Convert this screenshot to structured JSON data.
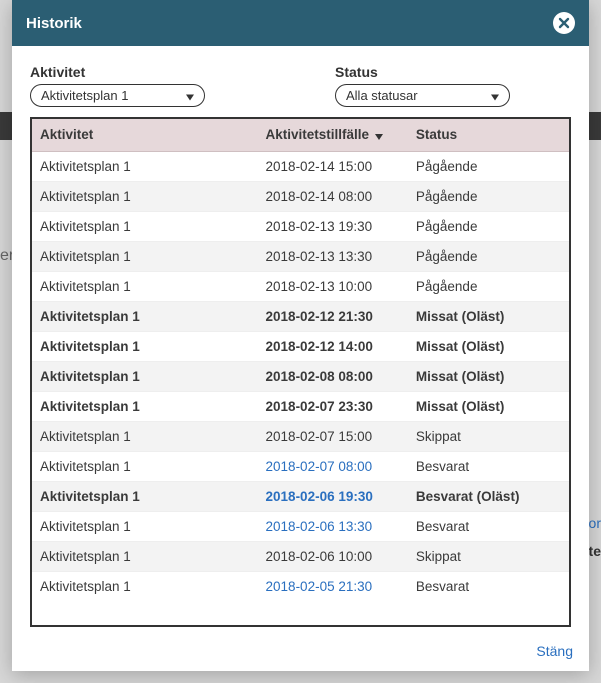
{
  "modal": {
    "title": "Historik",
    "close_label": "Stäng"
  },
  "filters": {
    "activity": {
      "label": "Aktivitet",
      "value": "Aktivitetsplan 1"
    },
    "status": {
      "label": "Status",
      "value": "Alla statusar"
    }
  },
  "table": {
    "columns": {
      "activity": "Aktivitet",
      "occasion": "Aktivitetstillfälle",
      "status": "Status"
    },
    "sort": {
      "column": "occasion",
      "dir": "desc"
    },
    "rows": [
      {
        "activity": "Aktivitetsplan 1",
        "time": "2018-02-14 15:00",
        "status": "Pågående",
        "bold": false,
        "link": false
      },
      {
        "activity": "Aktivitetsplan 1",
        "time": "2018-02-14 08:00",
        "status": "Pågående",
        "bold": false,
        "link": false
      },
      {
        "activity": "Aktivitetsplan 1",
        "time": "2018-02-13 19:30",
        "status": "Pågående",
        "bold": false,
        "link": false
      },
      {
        "activity": "Aktivitetsplan 1",
        "time": "2018-02-13 13:30",
        "status": "Pågående",
        "bold": false,
        "link": false
      },
      {
        "activity": "Aktivitetsplan 1",
        "time": "2018-02-13 10:00",
        "status": "Pågående",
        "bold": false,
        "link": false
      },
      {
        "activity": "Aktivitetsplan 1",
        "time": "2018-02-12 21:30",
        "status": "Missat (Oläst)",
        "bold": true,
        "link": false
      },
      {
        "activity": "Aktivitetsplan 1",
        "time": "2018-02-12 14:00",
        "status": "Missat (Oläst)",
        "bold": true,
        "link": false
      },
      {
        "activity": "Aktivitetsplan 1",
        "time": "2018-02-08 08:00",
        "status": "Missat (Oläst)",
        "bold": true,
        "link": false
      },
      {
        "activity": "Aktivitetsplan 1",
        "time": "2018-02-07 23:30",
        "status": "Missat (Oläst)",
        "bold": true,
        "link": false
      },
      {
        "activity": "Aktivitetsplan 1",
        "time": "2018-02-07 15:00",
        "status": "Skippat",
        "bold": false,
        "link": false
      },
      {
        "activity": "Aktivitetsplan 1",
        "time": "2018-02-07 08:00",
        "status": "Besvarat",
        "bold": false,
        "link": true
      },
      {
        "activity": "Aktivitetsplan 1",
        "time": "2018-02-06 19:30",
        "status": "Besvarat (Oläst)",
        "bold": true,
        "link": true
      },
      {
        "activity": "Aktivitetsplan 1",
        "time": "2018-02-06 13:30",
        "status": "Besvarat",
        "bold": false,
        "link": true
      },
      {
        "activity": "Aktivitetsplan 1",
        "time": "2018-02-06 10:00",
        "status": "Skippat",
        "bold": false,
        "link": false
      },
      {
        "activity": "Aktivitetsplan 1",
        "time": "2018-02-05 21:30",
        "status": "Besvarat",
        "bold": false,
        "link": true
      }
    ]
  },
  "background": {
    "t1": "or",
    "t2": "ite",
    "t3": "er"
  }
}
